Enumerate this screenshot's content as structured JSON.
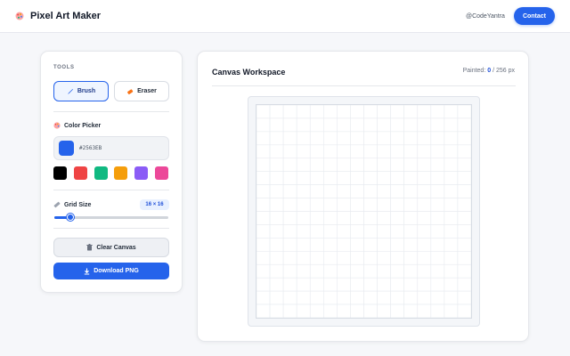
{
  "header": {
    "app_title": "Pixel Art Maker",
    "logo_icon": "palette-icon",
    "handle": "@CodeYantra",
    "contact_label": "Contact"
  },
  "sidebar": {
    "tools_label": "TOOLS",
    "tools": [
      {
        "label": "Brush",
        "icon": "brush-icon",
        "active": true
      },
      {
        "label": "Eraser",
        "icon": "eraser-icon",
        "active": false
      }
    ],
    "color_picker": {
      "label": "Color Picker",
      "icon": "palette-icon",
      "value": "#2563EB",
      "swatches": [
        "#000000",
        "#ef4444",
        "#10b981",
        "#f59e0b",
        "#8b5cf6",
        "#ec4899"
      ]
    },
    "grid_size": {
      "label": "Grid Size",
      "icon": "ruler-icon",
      "value_text": "16 × 16",
      "value": 16,
      "min": 8,
      "max": 64
    },
    "clear_label": "Clear Canvas",
    "clear_icon": "trash-icon",
    "download_label": "Download PNG",
    "download_icon": "download-icon"
  },
  "workspace": {
    "title": "Canvas Workspace",
    "painted_label": "Painted:",
    "painted_count": "0",
    "painted_total": "/ 256 px",
    "rows": 16,
    "cols": 16
  },
  "colors": {
    "accent": "#2563eb",
    "background": "#f6f7fa"
  }
}
